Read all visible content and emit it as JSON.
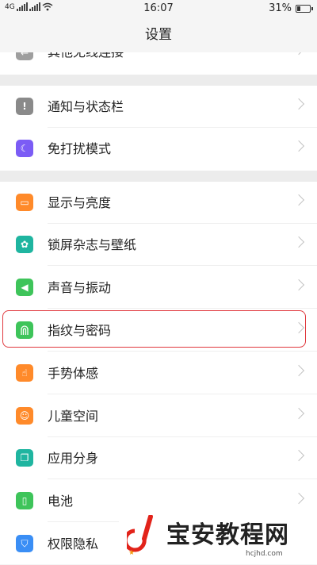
{
  "status_bar": {
    "carrier_left": "4G",
    "time": "16:07",
    "battery": "31%",
    "battery_level": 0.31
  },
  "header": {
    "title": "设置"
  },
  "items": [
    {
      "label": "其他无线连接",
      "icon": "link-icon",
      "color": "#9e9e9e"
    },
    {
      "label": "通知与状态栏",
      "icon": "notification-icon",
      "color": "#8a8a8a"
    },
    {
      "label": "免打扰模式",
      "icon": "moon-icon",
      "color": "#7b5cf5"
    },
    {
      "label": "显示与亮度",
      "icon": "display-icon",
      "color": "#ff8a2a"
    },
    {
      "label": "锁屏杂志与壁纸",
      "icon": "flower-icon",
      "color": "#1fb5a0"
    },
    {
      "label": "声音与振动",
      "icon": "speaker-icon",
      "color": "#3ec45a"
    },
    {
      "label": "指纹与密码",
      "icon": "fingerprint-icon",
      "color": "#3ec45a"
    },
    {
      "label": "手势体感",
      "icon": "gesture-icon",
      "color": "#ff8a2a"
    },
    {
      "label": "儿童空间",
      "icon": "child-icon",
      "color": "#ff8a2a"
    },
    {
      "label": "应用分身",
      "icon": "clone-icon",
      "color": "#1fb5a0"
    },
    {
      "label": "电池",
      "icon": "battery-icon",
      "color": "#3ec45a"
    },
    {
      "label": "权限隐私",
      "icon": "shield-icon",
      "color": "#3a8ef5"
    }
  ],
  "watermark": {
    "title": "宝安教程网",
    "url": "hcjhd.com",
    "logo_letter": "D"
  }
}
